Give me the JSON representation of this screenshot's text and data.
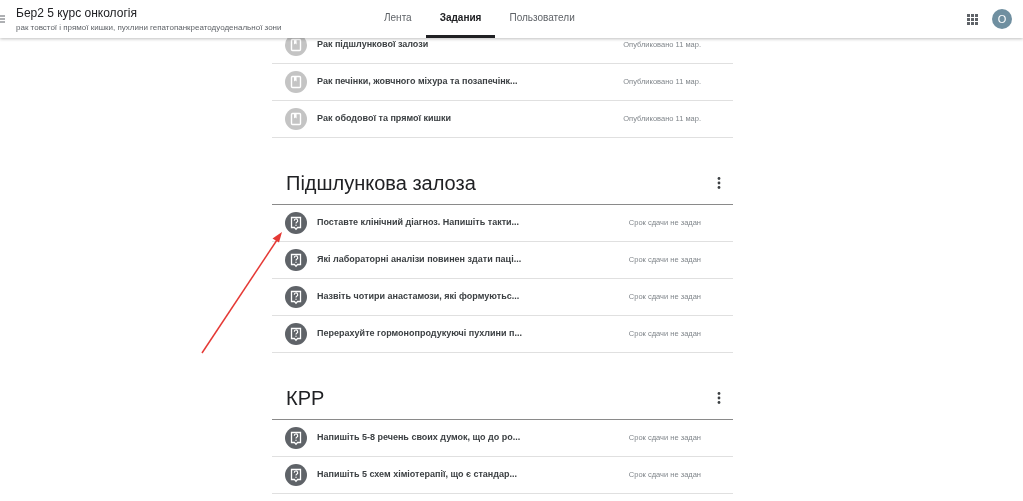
{
  "header": {
    "title": "Бер2 5 курс онкологія",
    "subtitle": "рак товстої і прямої кишки, пухлини гепатопанкреатодуоденальної зони",
    "avatar": "O"
  },
  "tabs": [
    {
      "label": "Лента",
      "selected": false
    },
    {
      "label": "Задания",
      "selected": true
    },
    {
      "label": "Пользователи",
      "selected": false
    }
  ],
  "sections": [
    {
      "items": [
        {
          "kind": "material",
          "title": "Рак підшлункової залози",
          "status": "Опубликовано 11 мар."
        },
        {
          "kind": "material",
          "title": "Рак печінки, жовчного міхура та позапечінк...",
          "status": "Опубликовано 11 мар."
        },
        {
          "kind": "material",
          "title": "Рак ободової та прямої кишки",
          "status": "Опубликовано 11 мар."
        }
      ]
    },
    {
      "title": "Підшлункова залоза",
      "items": [
        {
          "kind": "question",
          "title": "Поставте клінічний діагноз. Напишіть такти...",
          "status": "Срок сдачи не задан"
        },
        {
          "kind": "question",
          "title": "Які лабораторні аналізи повинен здати паці...",
          "status": "Срок сдачи не задан"
        },
        {
          "kind": "question",
          "title": "Назвіть чотири анастамози, які формуютьс...",
          "status": "Срок сдачи не задан"
        },
        {
          "kind": "question",
          "title": "Перерахуйте гормонопродукуючі пухлини п...",
          "status": "Срок сдачи не задан"
        }
      ]
    },
    {
      "title": "КРР",
      "items": [
        {
          "kind": "question",
          "title": "Напишіть 5-8 речень своих думок, що до ро...",
          "status": "Срок сдачи не задан"
        },
        {
          "kind": "question",
          "title": "Напишіть 5 схем хіміотерапії, що є стандар...",
          "status": "Срок сдачи не задан"
        }
      ]
    }
  ]
}
